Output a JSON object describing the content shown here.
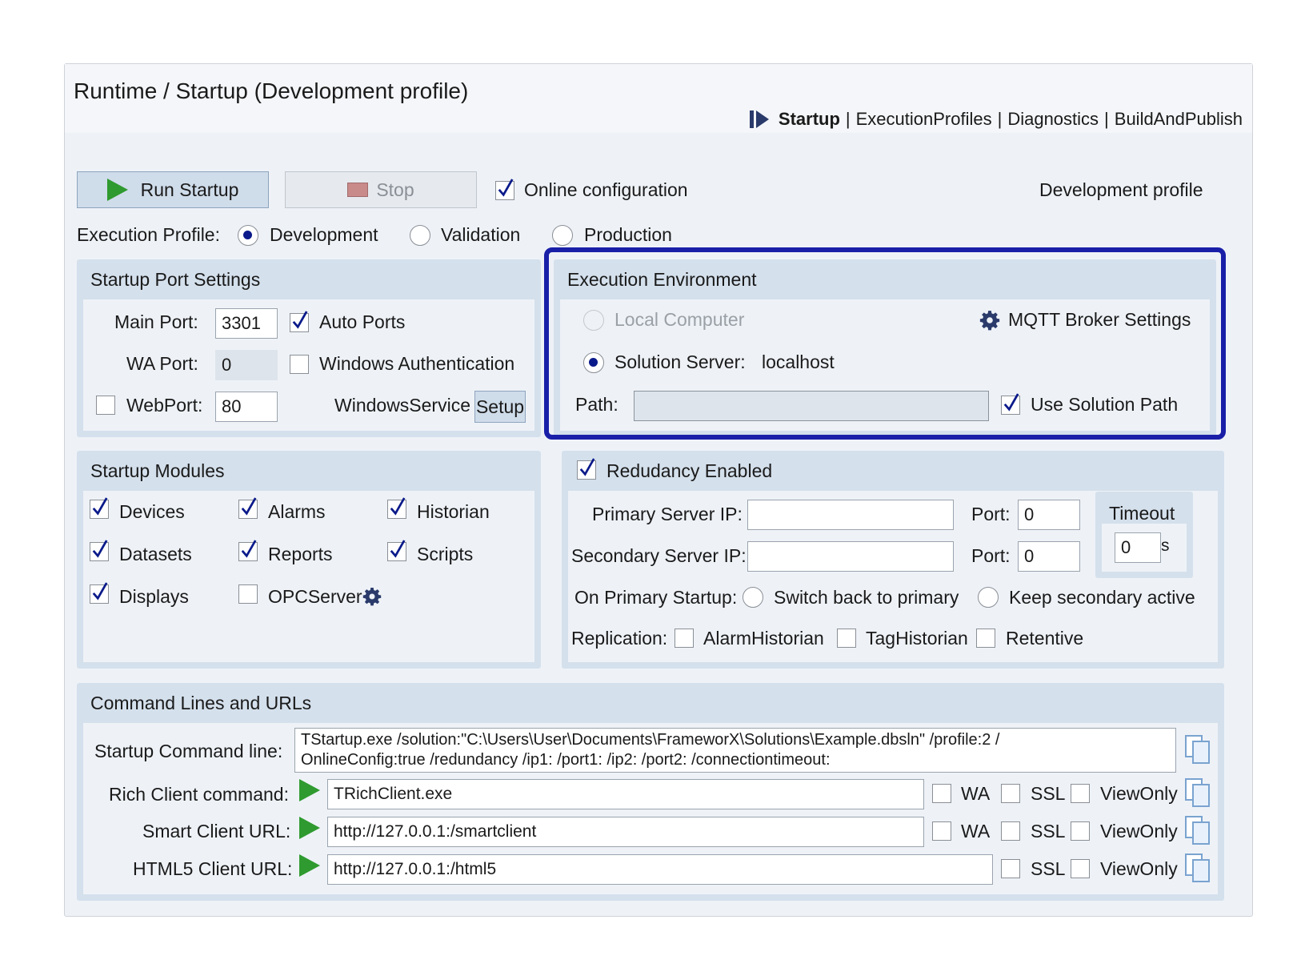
{
  "window": {
    "title": "Runtime / Startup (Development profile)",
    "tabs": [
      {
        "label": "Startup",
        "active": true
      },
      {
        "label": "ExecutionProfiles",
        "active": false
      },
      {
        "label": "Diagnostics",
        "active": false
      },
      {
        "label": "BuildAndPublish",
        "active": false
      }
    ],
    "separator": "|"
  },
  "toolbar": {
    "run_label": "Run Startup",
    "stop_label": "Stop",
    "online_config_label": "Online configuration",
    "online_config_checked": true,
    "profile_status": "Development profile"
  },
  "execution_profile": {
    "label": "Execution Profile:",
    "options": [
      "Development",
      "Validation",
      "Production"
    ],
    "selected": "Development"
  },
  "port_settings": {
    "header": "Startup Port Settings",
    "main_port_label": "Main Port:",
    "main_port_value": "3301",
    "auto_ports_label": "Auto Ports",
    "wa_port_label": "WA Port:",
    "wa_port_value": "0",
    "windows_auth_label": "Windows Authentication",
    "webport_label": "WebPort:",
    "webport_value": "80",
    "windows_service_label": "WindowsService",
    "setup_label": "Setup"
  },
  "execution_environment": {
    "header": "Execution Environment",
    "local_computer_label": "Local Computer",
    "mqtt_label": "MQTT Broker Settings",
    "solution_server_label": "Solution Server:",
    "solution_server_value": "localhost",
    "path_label": "Path:",
    "path_value": "",
    "use_solution_path_label": "Use Solution Path"
  },
  "modules": {
    "header": "Startup Modules",
    "items": [
      {
        "label": "Devices",
        "checked": true
      },
      {
        "label": "Alarms",
        "checked": true
      },
      {
        "label": "Historian",
        "checked": true
      },
      {
        "label": "Datasets",
        "checked": true
      },
      {
        "label": "Reports",
        "checked": true
      },
      {
        "label": "Scripts",
        "checked": true
      },
      {
        "label": "Displays",
        "checked": true
      },
      {
        "label": "OPCServer",
        "checked": false
      }
    ]
  },
  "redundancy": {
    "enabled_label": "Redudancy Enabled",
    "primary_ip_label": "Primary Server IP:",
    "primary_ip_value": "",
    "secondary_ip_label": "Secondary Server IP:",
    "secondary_ip_value": "",
    "port_label": "Port:",
    "primary_port_value": "0",
    "secondary_port_value": "0",
    "timeout_label": "Timeout",
    "timeout_value": "0",
    "timeout_unit": "s",
    "on_primary_label": "On Primary Startup:",
    "switch_back_label": "Switch back to primary",
    "keep_secondary_label": "Keep secondary active",
    "replication_label": "Replication:",
    "replication_items": [
      "AlarmHistorian",
      "TagHistorian",
      "Retentive"
    ]
  },
  "commands": {
    "header": "Command Lines and URLs",
    "startup_label": "Startup Command line:",
    "startup_line1": "TStartup.exe /solution:\"C:\\Users\\User\\Documents\\FrameworX\\Solutions\\Example.dbsln\" /profile:2 /",
    "startup_line2": "OnlineConfig:true /redundancy /ip1: /port1: /ip2: /port2: /connectiontimeout:",
    "rich_label": "Rich Client command:",
    "rich_value": "TRichClient.exe",
    "smart_label": "Smart Client URL:",
    "smart_value": "http://127.0.0.1:/smartclient",
    "html5_label": "HTML5 Client URL:",
    "html5_value": "http://127.0.0.1:/html5",
    "wa_label": "WA",
    "ssl_label": "SSL",
    "viewonly_label": "ViewOnly"
  },
  "colors": {
    "highlight_border": "#1a1fa8",
    "panel_header": "#d4e0ec",
    "play_green": "#2f9a2f",
    "check_blue": "#0a1a8a"
  }
}
